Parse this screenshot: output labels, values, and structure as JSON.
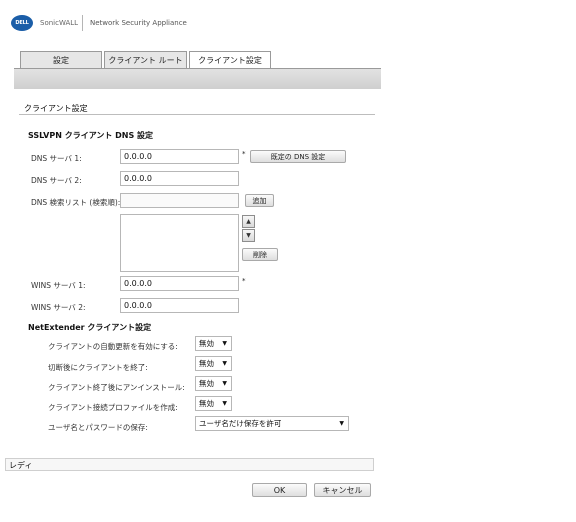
{
  "header": {
    "logo_text": "DELL",
    "brand": "SonicWALL",
    "product": "Network Security Appliance"
  },
  "tabs": [
    {
      "label": "設定"
    },
    {
      "label": "クライアント ルート"
    },
    {
      "label": "クライアント設定"
    }
  ],
  "section": {
    "title": "クライアント設定"
  },
  "dns": {
    "heading": "SSLVPN クライアント DNS 設定",
    "server1_label": "DNS サーバ 1:",
    "server1_value": "0.0.0.0",
    "server1_mark": "*",
    "default_dns_button": "既定の DNS 設定",
    "server2_label": "DNS サーバ 2:",
    "server2_value": "0.0.0.0",
    "search_list_label": "DNS 検索リスト (検索順):",
    "search_input_value": "",
    "add_button": "追加",
    "delete_button": "削除",
    "up_icon": "arrow-up-icon",
    "down_icon": "arrow-down-icon"
  },
  "wins": {
    "server1_label": "WINS サーバ 1:",
    "server1_value": "0.0.0.0",
    "server1_mark": "*",
    "server2_label": "WINS サーバ 2:",
    "server2_value": "0.0.0.0"
  },
  "netextender": {
    "heading": "NetExtender クライアント設定",
    "rows": [
      {
        "label": "クライアントの自動更新を有効にする:",
        "value": "無効"
      },
      {
        "label": "切断後にクライアントを終了:",
        "value": "無効"
      },
      {
        "label": "クライアント終了後にアンインストール:",
        "value": "無効"
      },
      {
        "label": "クライアント接続プロファイルを作成:",
        "value": "無効"
      }
    ],
    "credentials_label": "ユーザ名とパスワードの保存:",
    "credentials_value": "ユーザ名だけ保存を許可"
  },
  "status": {
    "text": "レディ"
  },
  "footer": {
    "ok_label": "OK",
    "cancel_label": "キャンセル"
  },
  "colors": {
    "accent": "#1b5ea8",
    "tab_bg": "#e6e6e6",
    "band": "#d6d6d6"
  }
}
